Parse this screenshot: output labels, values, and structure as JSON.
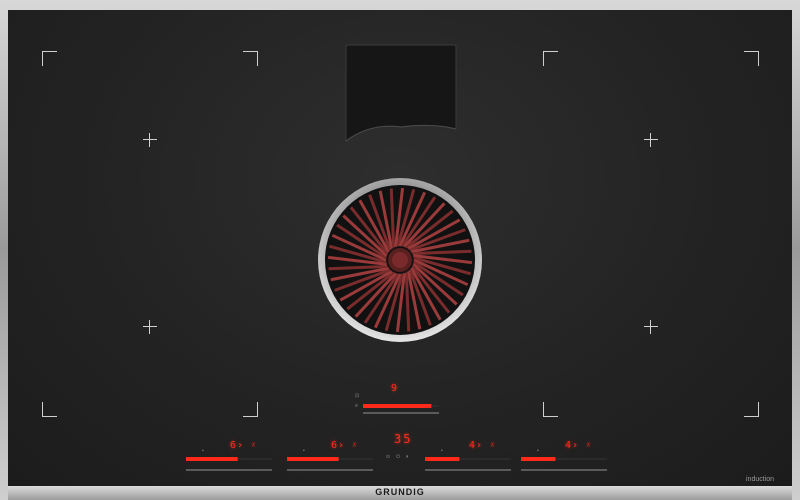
{
  "brand": "GRUNDIG",
  "surface_label": "induction",
  "extractor": {
    "level": "9",
    "level_fraction": 0.9
  },
  "timer": {
    "value": "35"
  },
  "zones": [
    {
      "id": "front-left",
      "level": "6",
      "level_fraction": 0.6
    },
    {
      "id": "front-center-left",
      "level": "6",
      "level_fraction": 0.6
    },
    {
      "id": "front-center-right",
      "level": "4",
      "level_fraction": 0.4
    },
    {
      "id": "front-right",
      "level": "4",
      "level_fraction": 0.4
    }
  ],
  "colors": {
    "glass": "#232323",
    "led_red": "#ff2a1a",
    "trim": "#b5b5b5",
    "vent_red": "#8a2a2a"
  },
  "icons": [
    "plus-icon",
    "corner-marker-icon",
    "lock-icon",
    "power-icon",
    "pause-icon",
    "boost-icon"
  ]
}
